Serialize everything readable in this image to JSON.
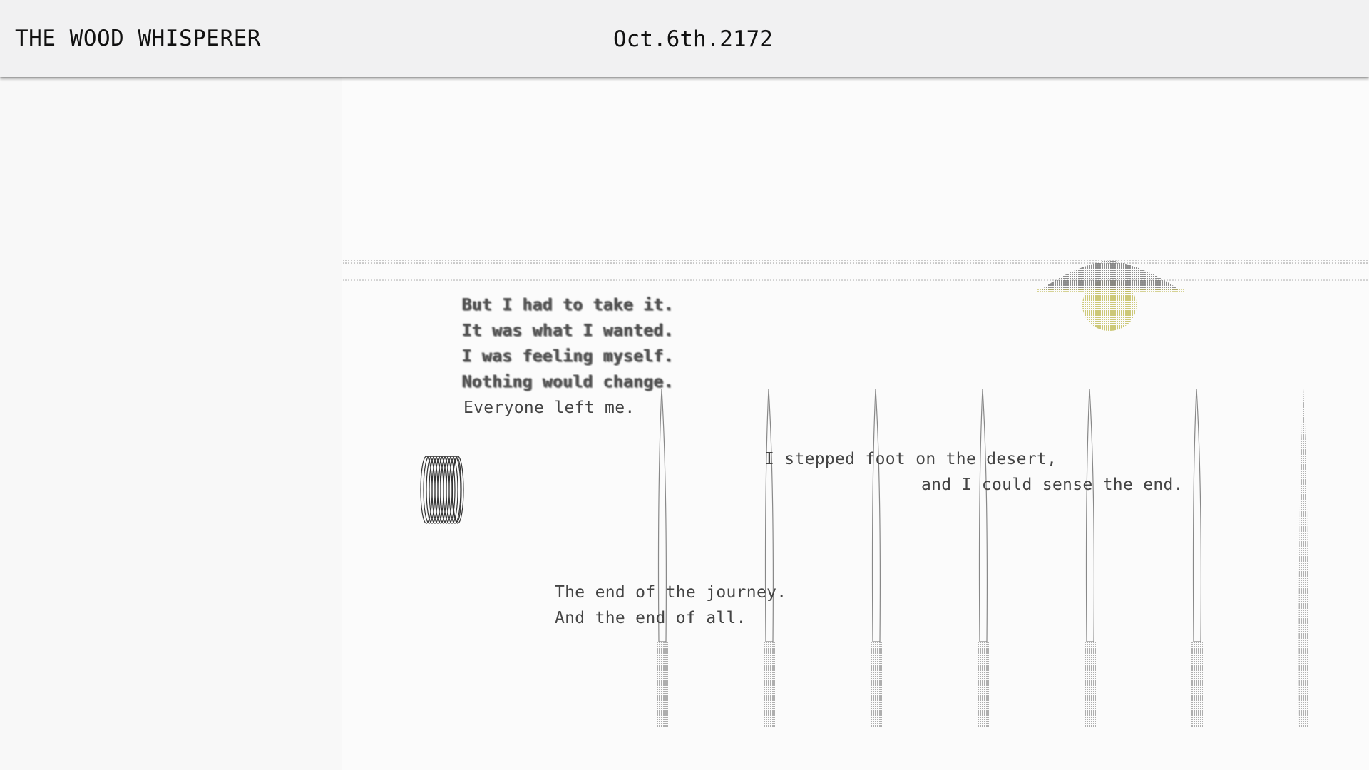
{
  "header": {
    "title": "THE WOOD WHISPERER",
    "date": "Oct.6th.2172"
  },
  "story": {
    "redacted_lines": [
      "But I had to take it.",
      "It was what I wanted.",
      "I was feeling myself.",
      "Nothing would change."
    ],
    "line_everyone": "Everyone left me.",
    "desert_line_1": "I stepped foot on the desert,",
    "desert_line_2": "and I could sense the end.",
    "journey_line_1": "The end of the journey.",
    "journey_line_2": "And the end of all."
  },
  "colors": {
    "ink": "#3a3a3a",
    "sun_glow": "#c8c24a",
    "sun_cloud": "#8a8a8a"
  },
  "icons": {
    "coil": "coil-icon",
    "horizon": "dotted-horizon",
    "sun": "sun-cloud-icon",
    "poles": "needle-pole-icon"
  }
}
